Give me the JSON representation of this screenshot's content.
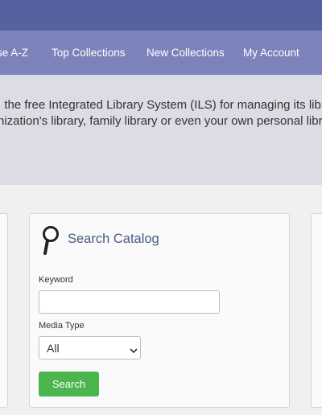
{
  "nav": {
    "items": [
      {
        "label": "se A-Z"
      },
      {
        "label": "Top Collections"
      },
      {
        "label": "New Collections"
      },
      {
        "label": "My Account"
      }
    ]
  },
  "hero": {
    "line1": ", the free Integrated Library System (ILS) for managing its library",
    "line2": "nization's library, family library or even your own personal library"
  },
  "search_card": {
    "icon": "magnifier-icon",
    "title": "Search Catalog",
    "keyword_label": "Keyword",
    "keyword_value": "",
    "media_type_label": "Media Type",
    "media_type_value": "All",
    "search_button": "Search"
  },
  "colors": {
    "topbar": "#5662a0",
    "navbar": "#7b83ba",
    "hero": "#dcdce4",
    "title_text": "#4a5a86",
    "button": "#4bb54e"
  }
}
